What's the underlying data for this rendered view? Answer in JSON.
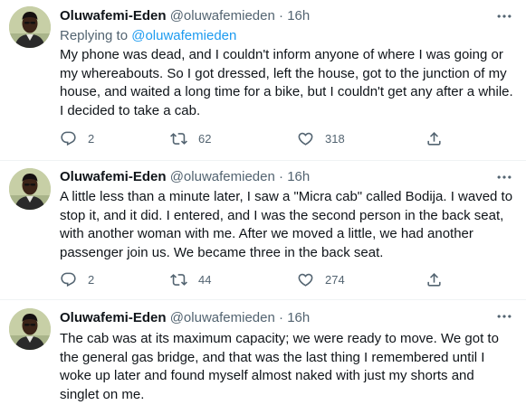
{
  "tweets": [
    {
      "name": "Oluwafemi-Eden",
      "handle": "@oluwafemieden",
      "separator": "·",
      "time": "16h",
      "replying_prefix": "Replying to",
      "replying_handle": "@oluwafemieden",
      "text": "My phone was dead, and I couldn't inform anyone of where I was going or\nmy whereabouts. So I got dressed, left the house, got to the junction of my\nhouse, and waited a long time for a bike, but I couldn't get any after a while.\nI decided to take a cab.",
      "replies": "2",
      "retweets": "62",
      "likes": "318"
    },
    {
      "name": "Oluwafemi-Eden",
      "handle": "@oluwafemieden",
      "separator": "·",
      "time": "16h",
      "text": "A little less than a minute later, I saw a \"Micra cab\" called Bodija. I waved to\nstop it, and it did. I entered, and I was the second person in the back seat,\nwith another woman with me. After we moved a little, we had another\npassenger join us. We became three in the back seat.",
      "replies": "2",
      "retweets": "44",
      "likes": "274"
    },
    {
      "name": "Oluwafemi-Eden",
      "handle": "@oluwafemieden",
      "separator": "·",
      "time": "16h",
      "text": "The cab was at its maximum capacity; we were ready to move. We got to\nthe general gas bridge, and that was the last thing I remembered until I\nwoke up later and found myself almost naked with just my shorts and\nsinglet on me."
    }
  ],
  "colors": {
    "text": "#0f1419",
    "secondary": "#536471",
    "link": "#1d9bf0",
    "divider": "#eff3f4"
  },
  "icons": {
    "more": "more-icon",
    "reply": "reply-icon",
    "retweet": "retweet-icon",
    "like": "like-icon",
    "share": "share-icon"
  }
}
